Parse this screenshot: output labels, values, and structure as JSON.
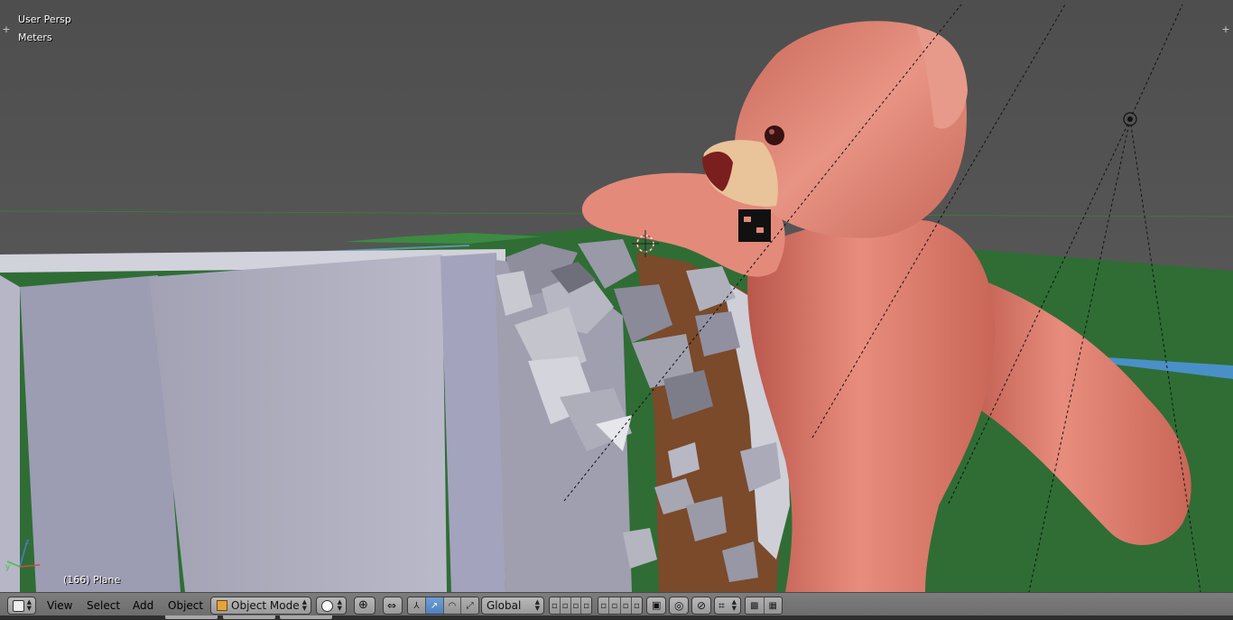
{
  "viewport": {
    "view_name": "User Persp",
    "units": "Meters",
    "object_info": "(166) Plane"
  },
  "header": {
    "editor_type_icon": "3d-view-icon",
    "menus": [
      "View",
      "Select",
      "Add",
      "Object"
    ],
    "mode": "Object Mode",
    "mode_icon": "cube-icon",
    "shading_icon": "sphere-icon",
    "pivot_icon": "pivot-icon",
    "orientation": "Global",
    "manipulator_icons": [
      "manipulator-axis-icon",
      "translate-icon",
      "rotate-icon",
      "scale-icon"
    ]
  },
  "colors": {
    "background": "#5a5a5a",
    "header": "#727272",
    "accent": "#5680c2",
    "bear": "#d9786a",
    "ground": "#2d6a33"
  }
}
